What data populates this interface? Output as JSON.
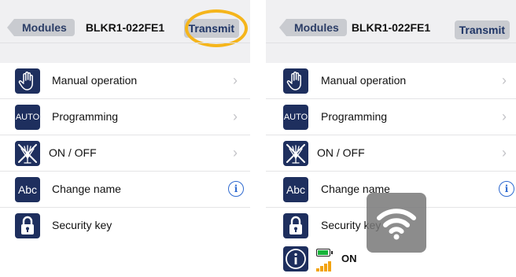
{
  "nav": {
    "back_label": "Modules",
    "title": "BLKR1-022FE1",
    "transmit_label": "Transmit"
  },
  "menu": [
    {
      "label": "Manual operation",
      "icon": "hand-icon",
      "accessory": "chevron"
    },
    {
      "label": "Programming",
      "icon": "auto-icon",
      "icon_text": "AUTO",
      "accessory": "chevron"
    },
    {
      "label": "ON / OFF",
      "icon": "sprinkler-off-icon",
      "accessory": "chevron"
    },
    {
      "label": "Change name",
      "icon": "abc-icon",
      "icon_text": "Abc",
      "accessory": "info"
    },
    {
      "label": "Security key",
      "icon": "lock-icon",
      "accessory": "none"
    }
  ],
  "status": {
    "label": "ON",
    "icon": "info-icon",
    "battery_level": 0.9
  },
  "accessory_glyphs": {
    "chevron": "›",
    "info": "i"
  },
  "colors": {
    "icon_bg": "#1e2f5e",
    "highlight": "#f5b51b",
    "button_bg": "#c9cbd0",
    "button_text": "#1f3566",
    "info_blue": "#2f6ad0",
    "battery_green": "#18b43a",
    "signal_orange": "#f2a30f"
  }
}
